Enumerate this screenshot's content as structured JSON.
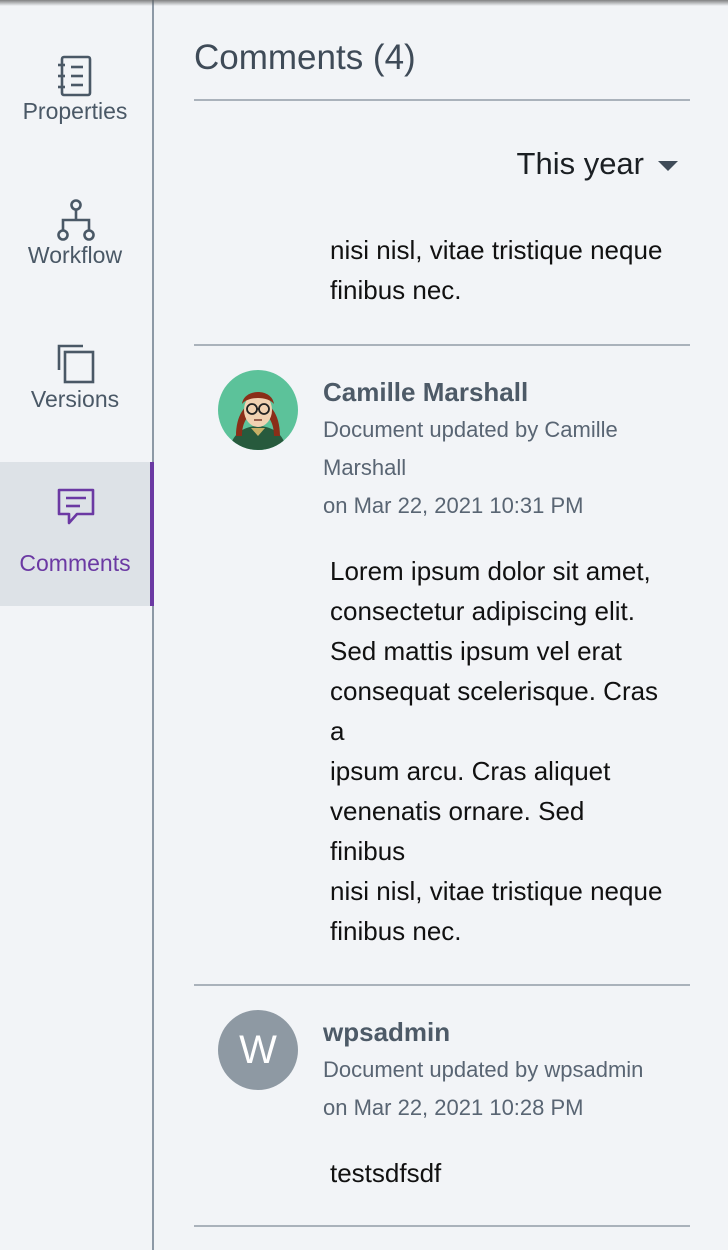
{
  "rail": {
    "items": [
      {
        "label": "Properties",
        "icon": "properties-icon"
      },
      {
        "label": "Workflow",
        "icon": "workflow-icon"
      },
      {
        "label": "Versions",
        "icon": "versions-icon"
      },
      {
        "label": "Comments",
        "icon": "comments-icon",
        "active": true
      }
    ]
  },
  "panel": {
    "title": "Comments (4)",
    "filter_label": "This year"
  },
  "comments": [
    {
      "body": "nisi nisl, vitae tristique neque\nfinibus nec."
    },
    {
      "author": "Camille Marshall",
      "action": "Document updated by Camille Marshall",
      "date": "on Mar 22, 2021 10:31 PM",
      "avatar": "cartoon-portrait",
      "body": "Lorem ipsum dolor sit amet,\nconsectetur adipiscing elit.\nSed mattis ipsum vel erat\nconsequat scelerisque. Cras\na\nipsum arcu. Cras aliquet\nvenenatis ornare. Sed\nfinibus\nnisi nisl, vitae tristique neque\nfinibus nec."
    },
    {
      "author": "wpsadmin",
      "action": "Document updated by wpsadmin",
      "date": "on Mar 22, 2021 10:28 PM",
      "avatar_letter": "W",
      "body": "testsdfsdf"
    }
  ],
  "colors": {
    "accent": "#6b39a3",
    "background": "#f2f4f7",
    "text": "#3f4b58"
  }
}
